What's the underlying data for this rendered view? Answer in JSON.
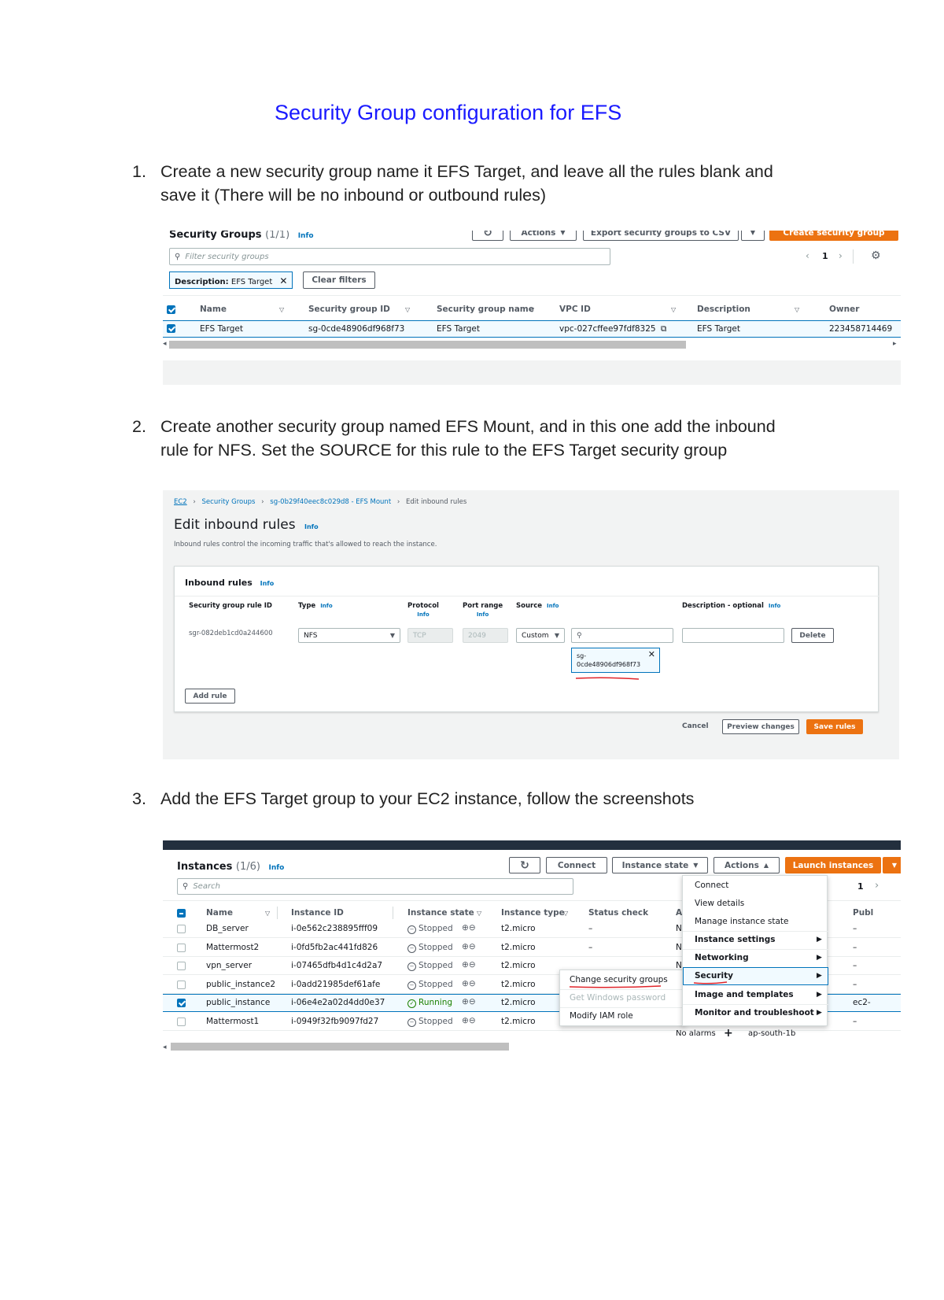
{
  "doc": {
    "title": "Security Group configuration for EFS",
    "steps": [
      {
        "num": "1.",
        "line1": "Create a new security group name it EFS Target, and leave all the rules blank and",
        "line2": "save it (There will be no inbound or outbound rules)"
      },
      {
        "num": "2.",
        "line1": "Create another security group named EFS Mount, and in this one add the inbound",
        "line2": "rule for NFS. Set the SOURCE for this rule to the EFS Target security group"
      },
      {
        "num": "3.",
        "line1": "Add the EFS Target group to your EC2 instance, follow the screenshots",
        "line2": ""
      }
    ]
  },
  "shot1": {
    "title": "Security Groups",
    "count": "(1/1)",
    "info": "Info",
    "actions_label": "Actions",
    "export_label": "Export security groups to CSV",
    "create_label": "Create security group",
    "filter_placeholder": "Filter security groups",
    "page": "1",
    "filter_token_key": "Description:",
    "filter_token_val": "EFS Target",
    "clear_filters": "Clear filters",
    "columns": [
      "Name",
      "Security group ID",
      "Security group name",
      "VPC ID",
      "Description",
      "Owner"
    ],
    "row": {
      "name": "EFS Target",
      "sg_id": "sg-0cde48906df968f73",
      "sg_name": "EFS Target",
      "vpc_id": "vpc-027cffee97fdf8325",
      "description": "EFS Target",
      "owner": "223458714469"
    }
  },
  "shot2": {
    "crumbs": [
      "EC2",
      "Security Groups",
      "sg-0b29f40eec8c029d8 - EFS Mount",
      "Edit inbound rules"
    ],
    "title": "Edit inbound rules",
    "info": "Info",
    "subtitle": "Inbound rules control the incoming traffic that's allowed to reach the instance.",
    "card_title": "Inbound rules",
    "col_rule_id": "Security group rule ID",
    "col_type": "Type",
    "col_protocol": "Protocol",
    "col_port": "Port range",
    "col_source": "Source",
    "col_desc": "Description - optional",
    "rule_id": "sgr-082deb1cd0a244600",
    "type_value": "NFS",
    "protocol_value": "TCP",
    "port_value": "2049",
    "source_value": "Custom",
    "token_line1": "sg-",
    "token_line2": "0cde48906df968f73",
    "delete_label": "Delete",
    "add_rule_label": "Add rule",
    "cancel_label": "Cancel",
    "preview_label": "Preview changes",
    "save_label": "Save rules"
  },
  "shot3": {
    "title": "Instances",
    "count": "(1/6)",
    "info": "Info",
    "connect_label": "Connect",
    "instance_state_label": "Instance state",
    "actions_label": "Actions",
    "launch_label": "Launch instances",
    "search_placeholder": "Search",
    "page": "1",
    "columns": [
      "Name",
      "Instance ID",
      "Instance state",
      "Instance type",
      "Status check",
      "Ala",
      "Publ"
    ],
    "rows": [
      {
        "name": "DB_server",
        "id": "i-0e562c238895fff09",
        "state": "Stopped",
        "type": "t2.micro",
        "status": "–",
        "alarm": "No",
        "pub": "–"
      },
      {
        "name": "Mattermost2",
        "id": "i-0fd5fb2ac441fd826",
        "state": "Stopped",
        "type": "t2.micro",
        "status": "–",
        "alarm": "No",
        "pub": "–"
      },
      {
        "name": "vpn_server",
        "id": "i-07465dfb4d1c4d2a7",
        "state": "Stopped",
        "type": "t2.micro",
        "status": "",
        "alarm": "No",
        "pub": "–"
      },
      {
        "name": "public_instance2",
        "id": "i-0add21985def61afe",
        "state": "Stopped",
        "type": "t2.micro",
        "status": "",
        "alarm": "",
        "pub": "–"
      },
      {
        "name": "public_instance",
        "id": "i-06e4e2a02d4dd0e37",
        "state": "Running",
        "type": "t2.micro",
        "status": "",
        "alarm": "",
        "pub": "ec2-"
      },
      {
        "name": "Mattermost1",
        "id": "i-0949f32fb9097fd27",
        "state": "Stopped",
        "type": "t2.micro",
        "status": "–",
        "alarm": "No alarms",
        "pub": "–"
      }
    ],
    "az_partial": "ap-south-1b",
    "actions_menu": [
      "Connect",
      "View details",
      "Manage instance state",
      "Instance settings",
      "Networking",
      "Security",
      "Image and templates",
      "Monitor and troubleshoot"
    ],
    "security_submenu": [
      "Change security groups",
      "Get Windows password",
      "Modify IAM role"
    ]
  }
}
